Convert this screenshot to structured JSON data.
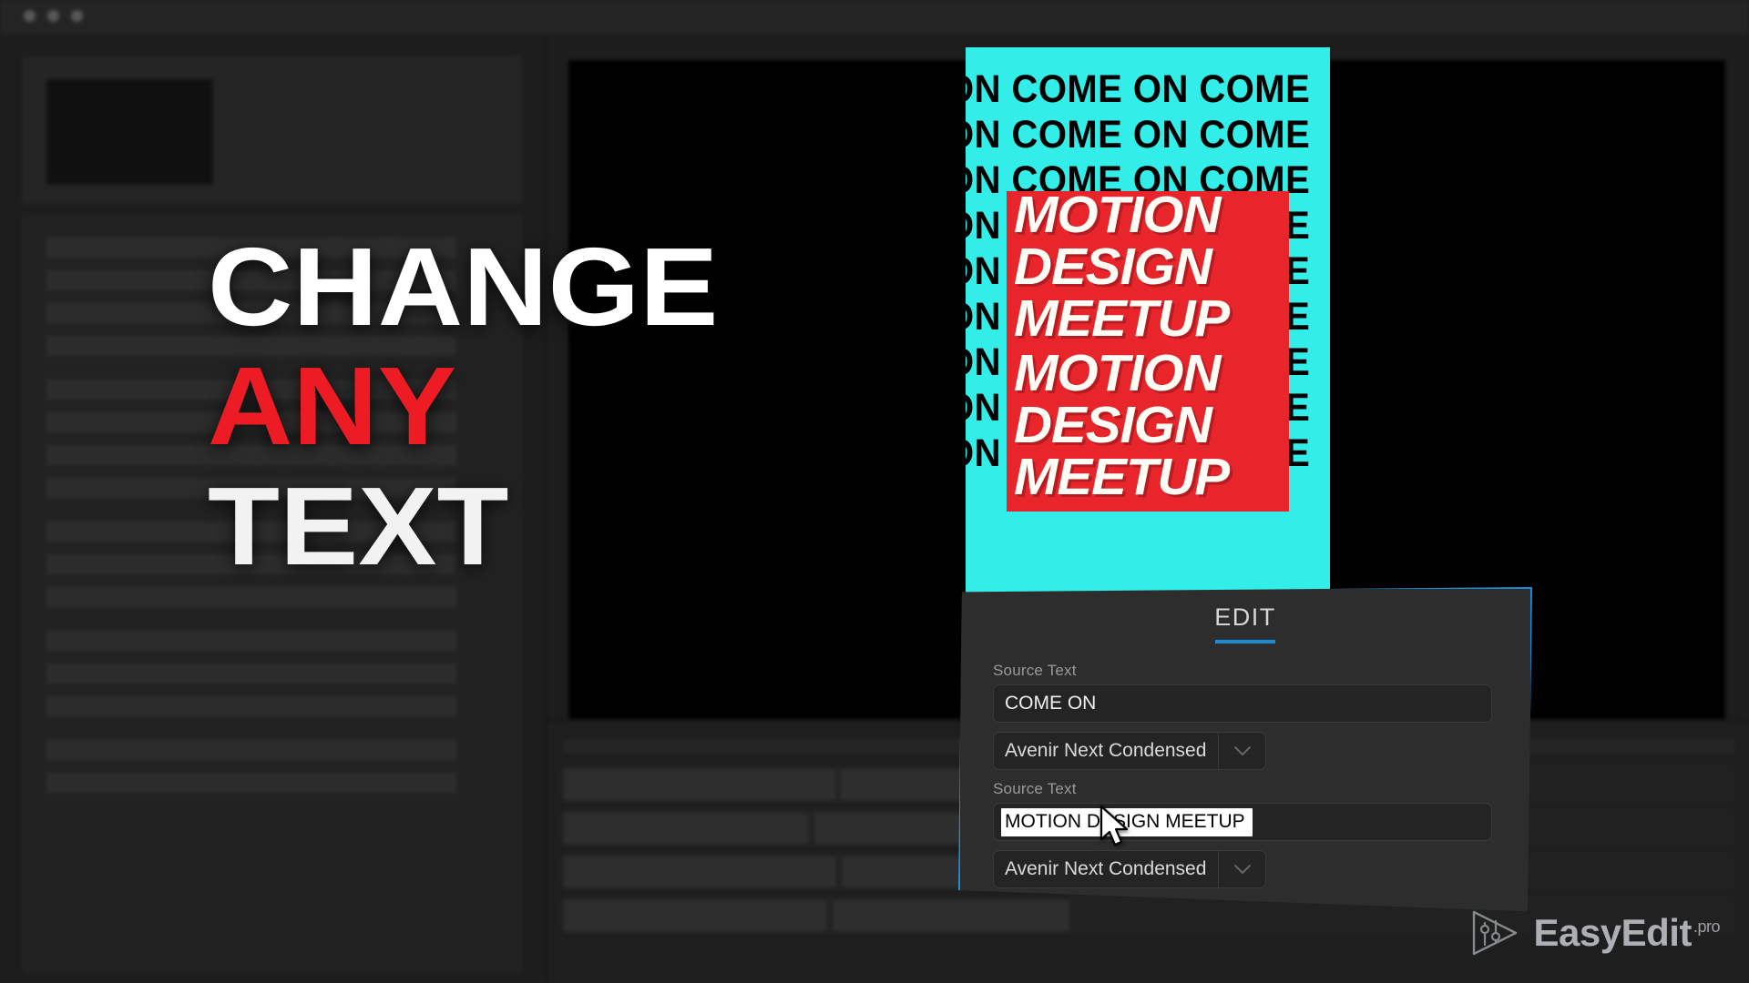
{
  "window": {
    "traffic_lights": [
      "close",
      "minimize",
      "maximize"
    ]
  },
  "headline": {
    "line1": "CHANGE",
    "line2": "ANY",
    "line3": "TEXT",
    "color_line1": "#FFFFFF",
    "color_line2": "#ED1C24",
    "color_line3": "#F2F2F2"
  },
  "composition": {
    "background_color": "#33EDE8",
    "accent_box_color": "#E8252B",
    "tile_lines": [
      "ON  COME ON COME",
      "ON  COME ON COME",
      "ON  COME ON COME",
      "ON  COME ON COME",
      "ON  COME ON COME",
      "ON  COME ON COME",
      "ON  COME ON COME",
      "ON  COME ON COME",
      "ON  COME ON COME"
    ],
    "headline_lines": [
      "MOTION",
      "DESIGN",
      "MEETUP",
      "MOTION",
      "DESIGN",
      "MEETUP"
    ]
  },
  "edit_panel": {
    "title": "EDIT",
    "accent_color": "#1C8DD6",
    "fields": [
      {
        "label": "Source Text",
        "value": "COME ON",
        "selected": false,
        "font": "Avenir Next Condensed",
        "dropdown_icon": "chevron-down-icon"
      },
      {
        "label": "Source Text",
        "value": "MOTION DESIGN MEETUP",
        "selected": true,
        "font": "Avenir Next Condensed",
        "dropdown_icon": "chevron-down-icon"
      }
    ]
  },
  "watermark": {
    "icon": "easyedit-play-sliders-icon",
    "name": "EasyEdit",
    "suffix": ".pro"
  },
  "cursor": {
    "icon": "mouse-pointer-icon"
  }
}
